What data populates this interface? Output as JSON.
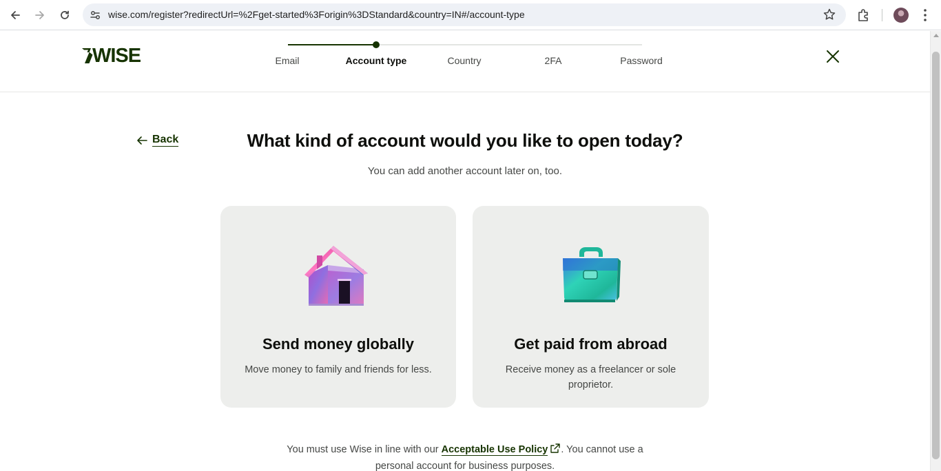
{
  "browser": {
    "url": "wise.com/register?redirectUrl=%2Fget-started%3Forigin%3DStandard&country=IN#/account-type",
    "back_icon": "arrow-left-icon",
    "forward_icon": "arrow-right-icon",
    "reload_icon": "reload-icon",
    "site_info_icon": "tune-icon",
    "bookmark_icon": "star-icon",
    "extensions_icon": "puzzle-icon",
    "menu_icon": "kebab-icon"
  },
  "header": {
    "logo_text": "7WISE",
    "steps": [
      {
        "label": "Email",
        "state": "done"
      },
      {
        "label": "Account type",
        "state": "current"
      },
      {
        "label": "Country",
        "state": "todo"
      },
      {
        "label": "2FA",
        "state": "todo"
      },
      {
        "label": "Password",
        "state": "todo"
      }
    ],
    "close_icon": "close-icon"
  },
  "main": {
    "back_label": "Back",
    "title": "What kind of account would you like to open today?",
    "subtitle": "You can add another account later on, too.",
    "cards": [
      {
        "title": "Send money globally",
        "description": "Move money to family and friends for less.",
        "illustration": "house-illustration"
      },
      {
        "title": "Get paid from abroad",
        "description": "Receive money as a freelancer or sole proprietor.",
        "illustration": "briefcase-illustration"
      }
    ],
    "footer": {
      "before": "You must use Wise in line with our ",
      "link": "Acceptable Use Policy",
      "after_line1": ". You cannot use a",
      "line2": "personal account for business purposes."
    }
  },
  "colors": {
    "brand_green": "#163300",
    "card_bg": "#edeeec",
    "text_primary": "#0e0f0c",
    "text_secondary": "#454745"
  }
}
